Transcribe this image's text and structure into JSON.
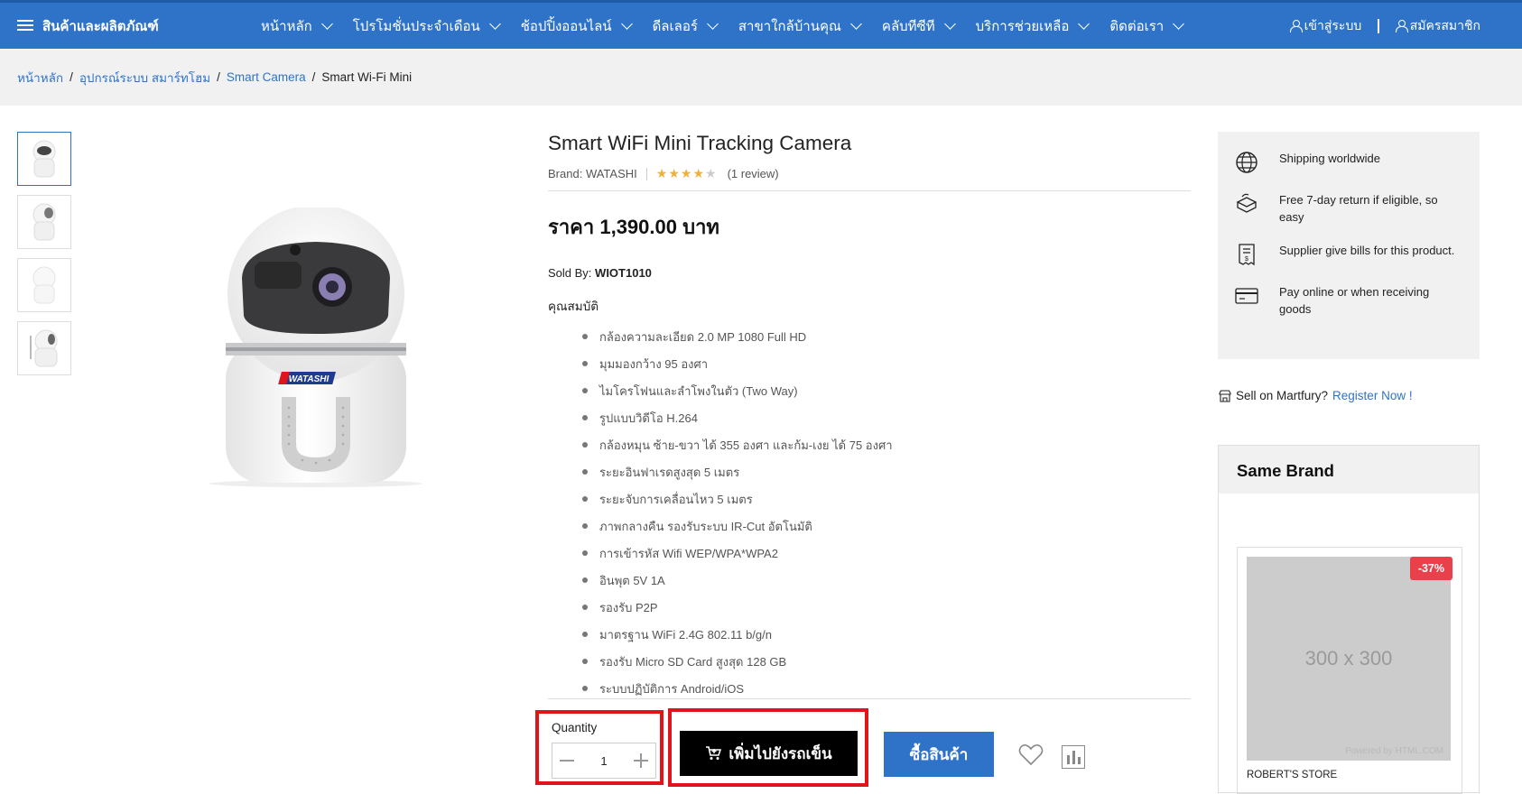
{
  "nav": {
    "category_menu": "สินค้าและผลิตภัณฑ์",
    "items": [
      "หน้าหลัก",
      "โปรโมชั่นประจำเดือน",
      "ช้อปปิ้งออนไลน์",
      "ดีลเลอร์",
      "สาขาใกล้บ้านคุณ",
      "คลับทีซีที",
      "บริการช่วยเหลือ",
      "ติดต่อเรา"
    ],
    "login": "เข้าสู่ระบบ",
    "register": "สมัครสมาชิก"
  },
  "breadcrumb": {
    "home": "หน้าหลัก",
    "category": "อุปกรณ์ระบบ สมาร์ทโฮม",
    "subcategory": "Smart Camera",
    "current": "Smart Wi-Fi Mini"
  },
  "product": {
    "title": "Smart WiFi Mini Tracking Camera",
    "brand_label": "Brand:",
    "brand": "WATASHI",
    "rating": 4,
    "rating_max": 5,
    "reviews": "(1 review)",
    "price": "ราคา 1,390.00 บาท",
    "sold_by_label": "Sold By:",
    "sold_by": "WIOT1010",
    "features_title": "คุณสมบัติ",
    "features": [
      "กล้องความละเอียด 2.0 MP  1080 Full HD",
      "มุมมองกว้าง 95 องศา",
      "ไมโครโฟนและลำโพงในตัว (Two Way)",
      "รูปแบบวิดีโอ H.264",
      "กล้องหมุน ซ้าย-ขวา ได้ 355 องศา และก้ม-เงย ได้ 75 องศา",
      "ระยะอินฟาเรดสูงสุด 5 เมตร",
      "ระยะจับการเคลื่อนไหว 5 เมตร",
      "ภาพกลางคืน รองรับระบบ IR-Cut อัตโนมัติ",
      "การเข้ารหัส Wifi WEP/WPA*WPA2",
      "อินพุต 5V 1A",
      "รองรับ P2P",
      "มาตรฐาน WiFi 2.4G 802.11 b/g/n",
      "รองรับ Micro SD Card สูงสุด 128 GB",
      "ระบบปฏิบัติการ Android/iOS"
    ],
    "quantity_label": "Quantity",
    "quantity": "1",
    "add_to_cart": "เพิ่มไปยังรถเข็น",
    "buy_now": "ซื้อสินค้า",
    "camera_logo": "WATASHI"
  },
  "services": [
    {
      "icon": "globe-icon",
      "text": "Shipping worldwide"
    },
    {
      "icon": "return-box-icon",
      "text": "Free 7-day return if eligible, so easy"
    },
    {
      "icon": "bill-icon",
      "text": "Supplier give bills for this product."
    },
    {
      "icon": "credit-card-icon",
      "text": "Pay online or when receiving goods"
    }
  ],
  "sell": {
    "text": "Sell on Martfury?",
    "link": "Register Now !"
  },
  "same_brand": {
    "title": "Same Brand",
    "card": {
      "image_text": "300 x 300",
      "powered": "Powered by HTML.COM",
      "discount": "-37%",
      "store": "ROBERT'S STORE"
    }
  },
  "colors": {
    "primary": "#2f73c9",
    "highlight": "#e0141c",
    "cart_button": "#000000",
    "star": "#f2b035",
    "discount_badge": "#e8414b"
  }
}
